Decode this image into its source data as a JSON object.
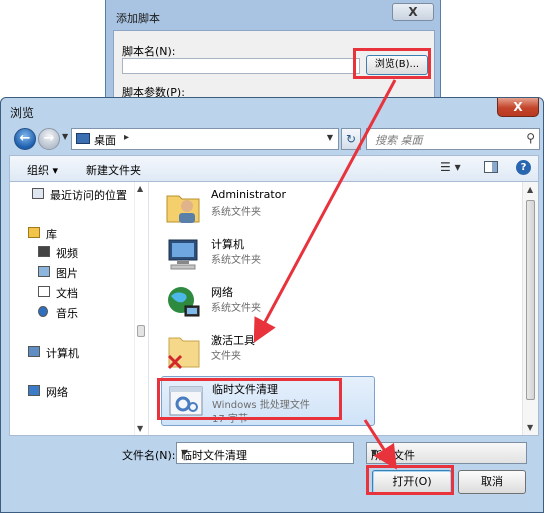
{
  "background_window": {
    "title": "添加脚本",
    "close_label": "X",
    "script_name_label": "脚本名(N):",
    "browse_button": "浏览(B)...",
    "script_params_label": "脚本参数(P):"
  },
  "dialog": {
    "title": "浏览",
    "close_label": "X"
  },
  "address_bar": {
    "location": "桌面",
    "separator": "▸"
  },
  "search": {
    "placeholder": "搜索 桌面"
  },
  "toolbar": {
    "organize": "组织 ▾",
    "new_folder": "新建文件夹"
  },
  "nav_pane": {
    "items": [
      {
        "label": "最近访问的位置",
        "icon": "recent-places-icon"
      },
      {
        "label": "库",
        "icon": "library-icon"
      },
      {
        "label": "视频",
        "icon": "video-icon"
      },
      {
        "label": "图片",
        "icon": "pictures-icon"
      },
      {
        "label": "文档",
        "icon": "documents-icon"
      },
      {
        "label": "音乐",
        "icon": "music-icon"
      },
      {
        "label": "计算机",
        "icon": "computer-icon"
      },
      {
        "label": "网络",
        "icon": "network-icon"
      }
    ]
  },
  "files": [
    {
      "name": "Administrator",
      "type": "系统文件夹",
      "size": "",
      "icon": "user-folder-icon"
    },
    {
      "name": "计算机",
      "type": "系统文件夹",
      "size": "",
      "icon": "computer-icon"
    },
    {
      "name": "网络",
      "type": "系统文件夹",
      "size": "",
      "icon": "network-globe-icon"
    },
    {
      "name": "激活工具",
      "type": "文件夹",
      "size": "",
      "icon": "folder-icon"
    },
    {
      "name": "临时文件清理",
      "type": "Windows 批处理文件",
      "size": "17 字节",
      "icon": "batch-file-icon"
    }
  ],
  "bottom": {
    "filename_label": "文件名(N):",
    "filename_value": "临时文件清理",
    "filetype_value": "所有文件",
    "open_button": "打开(O)",
    "cancel_button": "取消"
  },
  "colors": {
    "annotation_red": "#e8323c",
    "chrome_blue": "#bcd3ec",
    "selection": "#cfe3f8"
  }
}
